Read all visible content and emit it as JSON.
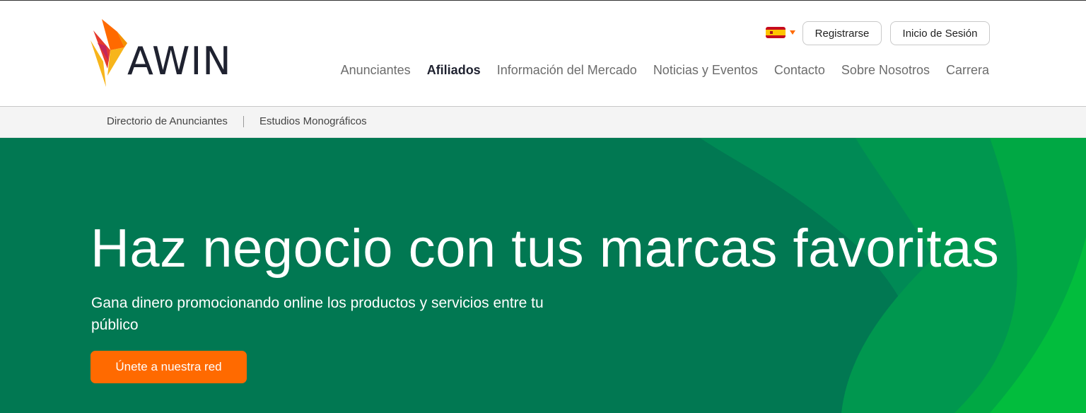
{
  "brand": {
    "name": "AWIN"
  },
  "header": {
    "register_label": "Registrarse",
    "login_label": "Inicio de Sesión",
    "nav": [
      {
        "label": "Anunciantes",
        "active": false
      },
      {
        "label": "Afiliados",
        "active": true
      },
      {
        "label": "Información del Mercado",
        "active": false
      },
      {
        "label": "Noticias y Eventos",
        "active": false
      },
      {
        "label": "Contacto",
        "active": false
      },
      {
        "label": "Sobre Nosotros",
        "active": false
      },
      {
        "label": "Carrera",
        "active": false
      }
    ]
  },
  "subnav": {
    "items": [
      {
        "label": "Directorio de Anunciantes"
      },
      {
        "label": "Estudios Monográficos"
      }
    ]
  },
  "hero": {
    "title": "Haz negocio con tus marcas favoritas",
    "subtitle": "Gana dinero promocionando online los productos y servicios entre tu público",
    "cta_label": "Únete a nuestra red"
  },
  "colors": {
    "accent": "#ff6a00",
    "hero_green": "#017852",
    "hero_green_light": "#00a63f"
  },
  "icons": {
    "language_flag": "spain-flag-icon",
    "language_caret": "caret-down-icon",
    "logo_mark": "awin-flame-logo"
  }
}
